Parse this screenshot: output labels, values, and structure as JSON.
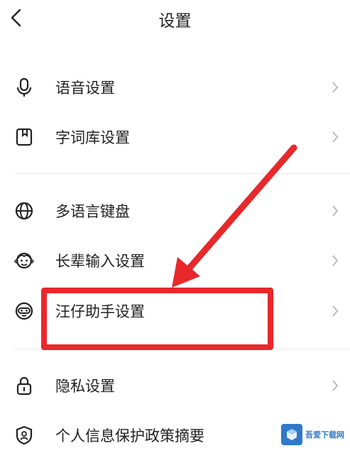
{
  "header": {
    "title": "设置"
  },
  "groups": [
    {
      "items": [
        {
          "label": "语音设置",
          "icon": "microphone-icon"
        },
        {
          "label": "字词库设置",
          "icon": "bookmark-icon"
        }
      ]
    },
    {
      "items": [
        {
          "label": "多语言键盘",
          "icon": "globe-icon"
        },
        {
          "label": "长辈输入设置",
          "icon": "elder-face-icon"
        },
        {
          "label": "汪仔助手设置",
          "icon": "mascot-icon"
        }
      ]
    },
    {
      "items": [
        {
          "label": "隐私设置",
          "icon": "lock-icon"
        },
        {
          "label": "个人信息保护政策摘要",
          "icon": "shield-user-icon"
        }
      ]
    }
  ],
  "annotation": {
    "highlight_color": "#e8282b"
  },
  "colors": {
    "text": "#222222",
    "chevron": "#b8b8b8",
    "divider": "#e9e9e9"
  },
  "watermark": {
    "text": "吾爱下载网"
  }
}
